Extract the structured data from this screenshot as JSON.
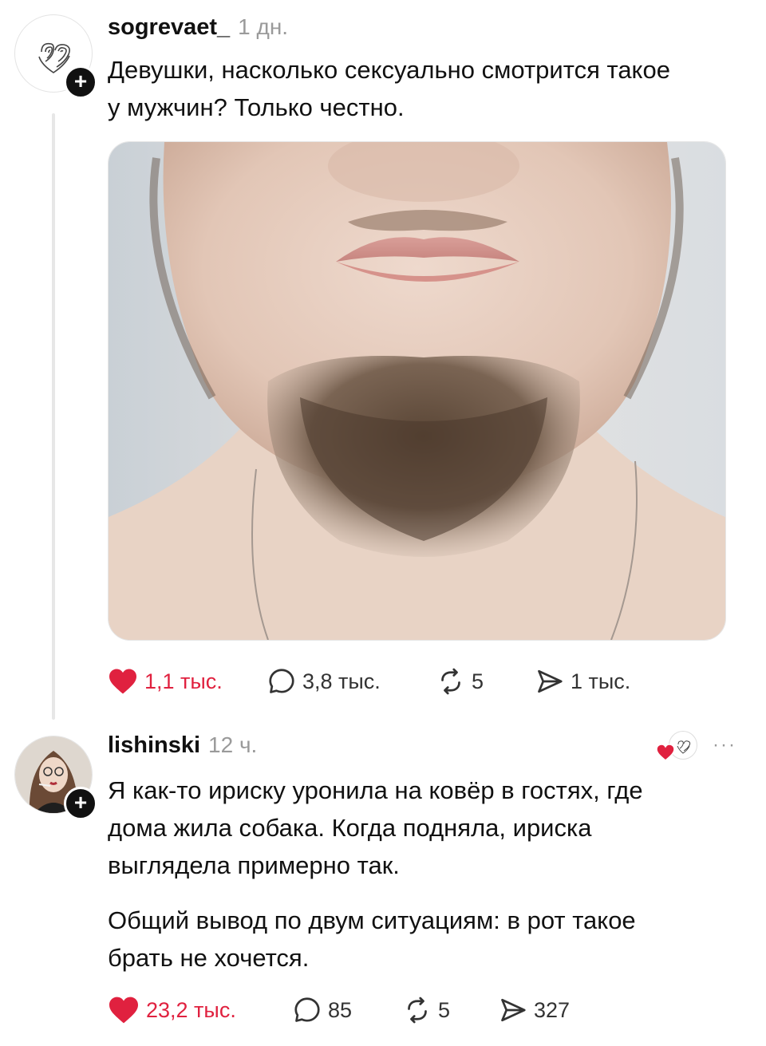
{
  "post1": {
    "username": "sogrevaet_",
    "time": "1 дн.",
    "text": "Девушки, насколько сексуально смотрится такое\nу мужчин? Только честно.",
    "avatar_icon": "fingerprint-heart-icon",
    "follow_label": "+",
    "stats": {
      "likes": "1,1 тыс.",
      "comments": "3,8 тыс.",
      "reposts": "5",
      "shares": "1 тыс."
    }
  },
  "post2": {
    "username": "lishinski",
    "time": "12 ч.",
    "text": "Я как-то ириску уронила на ковёр в гостях, где\nдома жила собака. Когда подняла, ириска\nвыглядела примерно так.",
    "text2": "Общий вывод по двум ситуациям: в рот такое\nбрать не хочется.",
    "follow_label": "+",
    "more_label": "···",
    "stats": {
      "likes": "23,2 тыс.",
      "comments": "85",
      "reposts": "5",
      "shares": "327"
    }
  },
  "colors": {
    "like": "#e0213f",
    "text": "#111111",
    "muted": "#9a9a9a"
  }
}
